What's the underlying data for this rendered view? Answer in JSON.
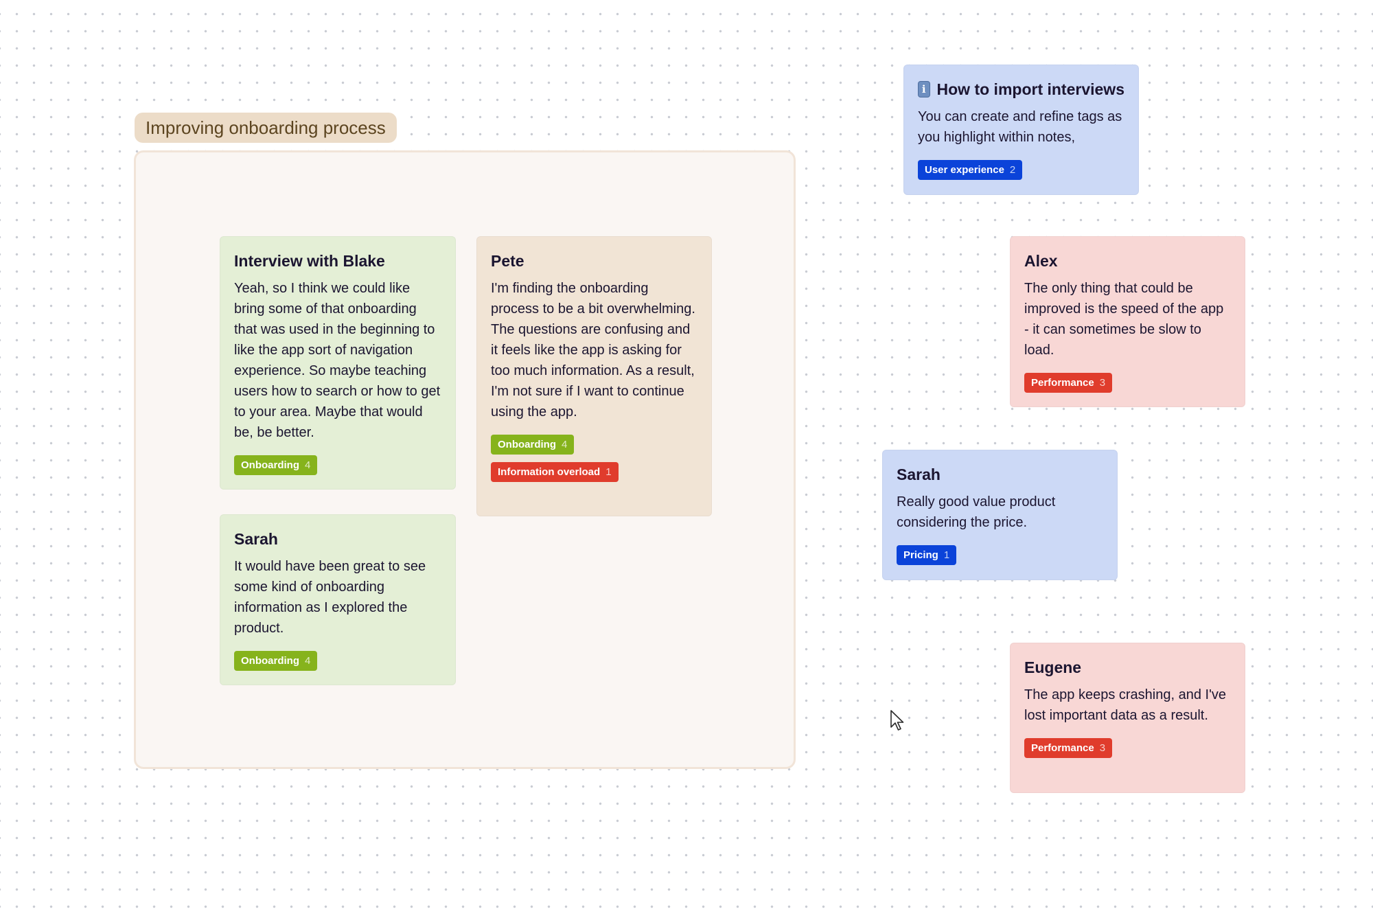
{
  "section": {
    "title": "Improving onboarding process"
  },
  "cards": {
    "blake": {
      "title": "Interview with Blake",
      "body": "Yeah, so I think we could like bring some of that onboarding that was used in the beginning to like the app sort of navigation experience. So maybe teaching users how to search or how to get to your area. Maybe that would be, be better.",
      "tags": [
        {
          "label": "Onboarding",
          "count": "4",
          "color": "#86b31c"
        }
      ]
    },
    "pete": {
      "title": "Pete",
      "body": "I'm finding the onboarding process to be a bit overwhelming. The questions are confusing and it feels like the app is asking for too much information. As a result, I'm not sure if I want to continue using the app.",
      "tags": [
        {
          "label": "Onboarding",
          "count": "4",
          "color": "#86b31c"
        },
        {
          "label": "Information overload",
          "count": "1",
          "color": "#e03c2c"
        }
      ]
    },
    "sarah_section": {
      "title": "Sarah",
      "body": "It would have been great to see some kind of onboarding information as I explored the product.",
      "tags": [
        {
          "label": "Onboarding",
          "count": "4",
          "color": "#86b31c"
        }
      ]
    },
    "import_info": {
      "icon": "info-icon",
      "title": "How to import interviews",
      "body": "You can create and refine tags as you highlight within notes,",
      "tags": [
        {
          "label": "User experience",
          "count": "2",
          "color": "#0b43d9"
        }
      ]
    },
    "alex": {
      "title": "Alex",
      "body": "The only thing that could be improved is the speed of the app - it can sometimes be slow to load.",
      "tags": [
        {
          "label": "Performance",
          "count": "3",
          "color": "#e03c2c"
        }
      ]
    },
    "sarah_pricing": {
      "title": "Sarah",
      "body": "Really good value product considering the price.",
      "tags": [
        {
          "label": "Pricing",
          "count": "1",
          "color": "#0b43d9"
        }
      ]
    },
    "eugene": {
      "title": "Eugene",
      "body": "The app keeps crashing, and I've lost important data as a result.",
      "tags": [
        {
          "label": "Performance",
          "count": "3",
          "color": "#e03c2c"
        }
      ]
    }
  },
  "cursor": {
    "icon": "mouse-pointer-icon"
  }
}
